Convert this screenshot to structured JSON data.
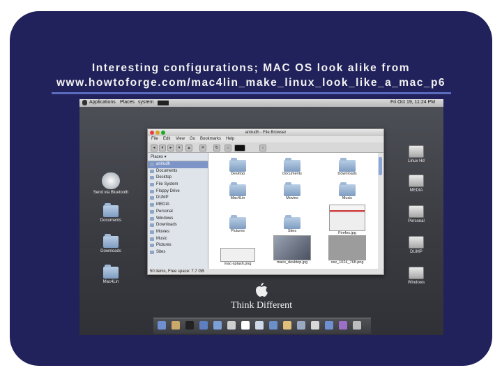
{
  "slide": {
    "title_line1": "Interesting configurations; MAC OS look alike from",
    "title_line2": "www.howtoforge.com/mac4lin_make_linux_look_like_a_mac_p6"
  },
  "topbar": {
    "menus": [
      "Applications",
      "Places",
      "system"
    ],
    "clock": "Fri Oct 19, 11:24 PM"
  },
  "desktop_left": [
    {
      "label": "Send via Bluetooth",
      "icon": "bluetooth-icon"
    },
    {
      "label": "Documents",
      "icon": "folder-icon"
    },
    {
      "label": "Downloads",
      "icon": "folder-icon"
    },
    {
      "label": "Mac4Lin",
      "icon": "folder-icon"
    }
  ],
  "desktop_right": [
    {
      "label": "Linux Hd",
      "icon": "drive-icon"
    },
    {
      "label": "MEDIA",
      "icon": "drive-icon"
    },
    {
      "label": "Personal",
      "icon": "drive-icon"
    },
    {
      "label": "DUMP",
      "icon": "drive-icon"
    },
    {
      "label": "Windows",
      "icon": "drive-icon"
    }
  ],
  "file_browser": {
    "title": "anirudh - File Browser",
    "menu": [
      "File",
      "Edit",
      "View",
      "Go",
      "Bookmarks",
      "Help"
    ],
    "places_label": "Places ▾",
    "sidebar": [
      "anirudh",
      "Documents",
      "Desktop",
      "File System",
      "Floppy Drive",
      "DUMP",
      "MEDIA",
      "Personal",
      "Windows",
      "Downloads",
      "Movies",
      "Music",
      "Pictures",
      "Sites"
    ],
    "files": [
      {
        "name": "Desktop",
        "kind": "folder"
      },
      {
        "name": "Documents",
        "kind": "folder"
      },
      {
        "name": "Downloads",
        "kind": "folder"
      },
      {
        "name": "Mac4Lin",
        "kind": "folder"
      },
      {
        "name": "Movies",
        "kind": "folder"
      },
      {
        "name": "Music",
        "kind": "folder"
      },
      {
        "name": "Pictures",
        "kind": "folder"
      },
      {
        "name": "Sites",
        "kind": "folder"
      },
      {
        "name": "Firefox.jpg",
        "kind": "image"
      },
      {
        "name": "mac-splash.png",
        "kind": "image"
      },
      {
        "name": "macs_desktop.jpg",
        "kind": "image"
      },
      {
        "name": "osx_1024_768.png",
        "kind": "image"
      }
    ],
    "status": "50 items, Free space: 7.7 GB"
  },
  "branding": {
    "tagline": "Think Different"
  },
  "dock": {
    "icon_colors": [
      "#6f8fd0",
      "#c9a86a",
      "#222222",
      "#5d7fbf",
      "#7ea0d8",
      "#cfcfcf",
      "#ffffff",
      "#cfd8e6",
      "#6a8fc9",
      "#e0c07a",
      "#9aa9c2",
      "#d8d8d8",
      "#6f8fd0",
      "#9b6fc7",
      "#bdbdbd"
    ]
  }
}
